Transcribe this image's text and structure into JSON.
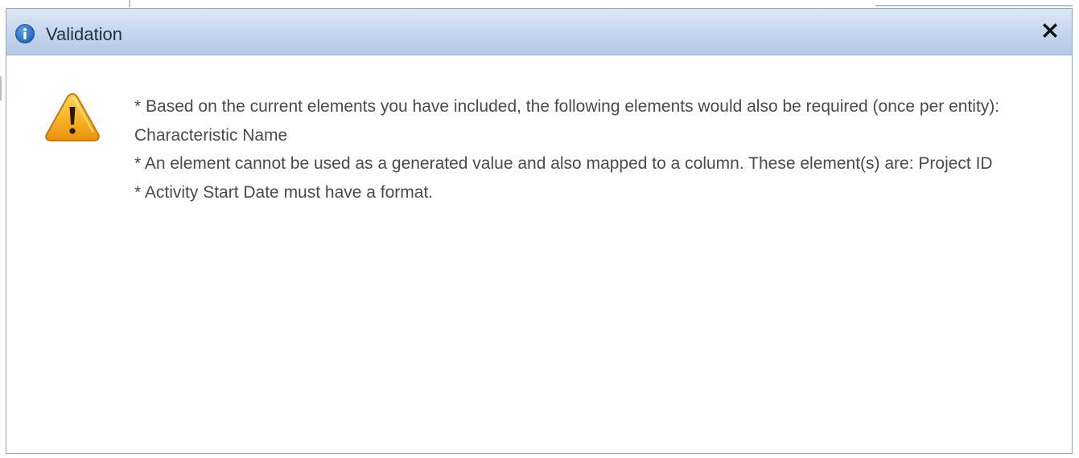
{
  "dialog": {
    "title": "Validation",
    "title_icon": "info-icon",
    "close_icon": "close-icon",
    "warning_icon": "warning-icon",
    "messages": [
      "* Based on the current elements you have included, the following elements would also be required (once per entity):  Characteristic Name",
      "* An element cannot be used as a generated value and also mapped to a column. These element(s) are:  Project ID",
      "* Activity Start Date must have a format."
    ]
  },
  "colors": {
    "titlebar_top": "#dfe8f5",
    "titlebar_bottom": "#b4c9e6",
    "info_blue": "#1d5fb0",
    "warning_orange": "#f3a51c",
    "message_text": "#4a4a4a"
  }
}
